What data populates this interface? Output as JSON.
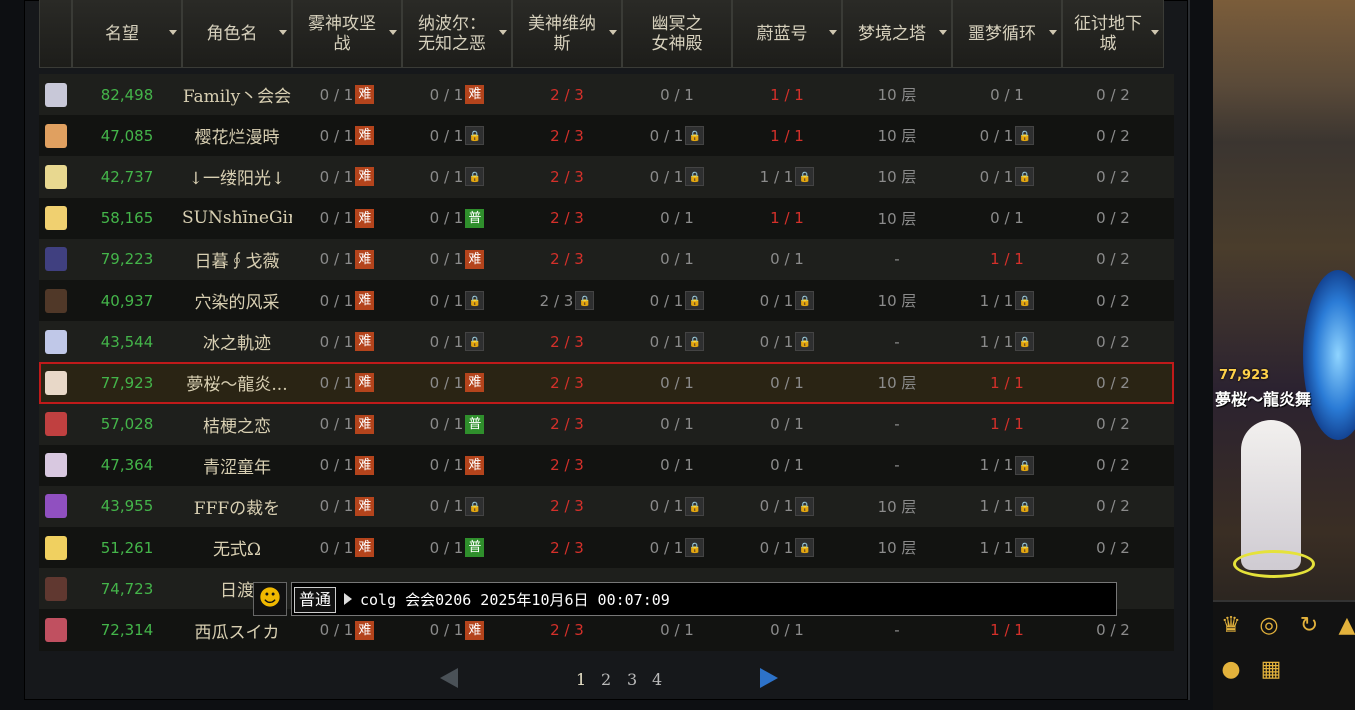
{
  "headers": [
    {
      "label": "名望"
    },
    {
      "label": "角色名"
    },
    {
      "label": "雾神攻坚\n战"
    },
    {
      "label": "纳波尔：\n无知之恶"
    },
    {
      "label": "美神维纳\n斯"
    },
    {
      "label": "幽冥之\n女神殿"
    },
    {
      "label": "蔚蓝号"
    },
    {
      "label": "梦境之塔"
    },
    {
      "label": "噩梦循环"
    },
    {
      "label": "征讨地下\n城"
    }
  ],
  "rows": [
    {
      "fame": "82,498",
      "name": "Family丶会会",
      "c1": "0 / 1",
      "t1": "难",
      "c2": "0 / 1",
      "t2": "难",
      "c3": "2 / 3",
      "c4": "0 / 1",
      "t4": "",
      "c5": "1 / 1",
      "t5": "",
      "c6": "10 层",
      "c7": "0 / 1",
      "t7": "",
      "c8": "0 / 2",
      "avatar": "#c8c8d8"
    },
    {
      "fame": "47,085",
      "name": "樱花烂漫時",
      "c1": "0 / 1",
      "t1": "难",
      "c2": "0 / 1",
      "t2": "锁",
      "c3": "2 / 3",
      "c4": "0 / 1",
      "t4": "锁",
      "c5": "1 / 1",
      "t5": "",
      "c6": "10 层",
      "c7": "0 / 1",
      "t7": "锁",
      "c8": "0 / 2",
      "avatar": "#e0a060"
    },
    {
      "fame": "42,737",
      "name": "↓一缕阳光↓",
      "c1": "0 / 1",
      "t1": "难",
      "c2": "0 / 1",
      "t2": "锁",
      "c3": "2 / 3",
      "c4": "0 / 1",
      "t4": "锁",
      "c5": "1 / 1",
      "t5": "锁",
      "c6": "10 层",
      "c7": "0 / 1",
      "t7": "锁",
      "c8": "0 / 2",
      "avatar": "#e8d890"
    },
    {
      "fame": "58,165",
      "name": "SUNshīneGir",
      "c1": "0 / 1",
      "t1": "难",
      "c2": "0 / 1",
      "t2": "普",
      "c3": "2 / 3",
      "c4": "0 / 1",
      "t4": "",
      "c5": "1 / 1",
      "t5": "",
      "c6": "10 层",
      "c7": "0 / 1",
      "t7": "",
      "c8": "0 / 2",
      "avatar": "#f0d070"
    },
    {
      "fame": "79,223",
      "name": "日暮∮戈薇",
      "c1": "0 / 1",
      "t1": "难",
      "c2": "0 / 1",
      "t2": "难",
      "c3": "2 / 3",
      "c4": "0 / 1",
      "t4": "",
      "c5": "0 / 1",
      "t5": "",
      "c6": "-",
      "c7": "1 / 1",
      "t7": "",
      "c8": "0 / 2",
      "avatar": "#404080"
    },
    {
      "fame": "40,937",
      "name": "穴染的风采",
      "c1": "0 / 1",
      "t1": "难",
      "c2": "0 / 1",
      "t2": "锁",
      "c3": "2 / 3",
      "t3": "锁",
      "c4": "0 / 1",
      "t4": "锁",
      "c5": "0 / 1",
      "t5": "锁",
      "c6": "10 层",
      "c7": "1 / 1",
      "t7": "锁",
      "c8": "0 / 2",
      "avatar": "#503828"
    },
    {
      "fame": "43,544",
      "name": "冰之軌迹",
      "c1": "0 / 1",
      "t1": "难",
      "c2": "0 / 1",
      "t2": "锁",
      "c3": "2 / 3",
      "c4": "0 / 1",
      "t4": "锁",
      "c5": "0 / 1",
      "t5": "锁",
      "c6": "-",
      "c7": "1 / 1",
      "t7": "锁",
      "c8": "0 / 2",
      "avatar": "#c0c8e8"
    },
    {
      "fame": "77,923",
      "name": "夢桜～龍炎...",
      "c1": "0 / 1",
      "t1": "难",
      "c2": "0 / 1",
      "t2": "难",
      "c3": "2 / 3",
      "c4": "0 / 1",
      "t4": "",
      "c5": "0 / 1",
      "t5": "",
      "c6": "10 层",
      "c7": "1 / 1",
      "t7": "",
      "c8": "0 / 2",
      "avatar": "#e8d8c8",
      "selected": true
    },
    {
      "fame": "57,028",
      "name": "桔梗之恋",
      "c1": "0 / 1",
      "t1": "难",
      "c2": "0 / 1",
      "t2": "普",
      "c3": "2 / 3",
      "c4": "0 / 1",
      "t4": "",
      "c5": "0 / 1",
      "t5": "",
      "c6": "-",
      "c7": "1 / 1",
      "t7": "",
      "c8": "0 / 2",
      "avatar": "#c04040"
    },
    {
      "fame": "47,364",
      "name": "青涩童年",
      "c1": "0 / 1",
      "t1": "难",
      "c2": "0 / 1",
      "t2": "难",
      "c3": "2 / 3",
      "c4": "0 / 1",
      "t4": "",
      "c5": "0 / 1",
      "t5": "",
      "c6": "-",
      "c7": "1 / 1",
      "t7": "锁",
      "c8": "0 / 2",
      "avatar": "#d8c8e0"
    },
    {
      "fame": "43,955",
      "name": "FFFの裁を",
      "c1": "0 / 1",
      "t1": "难",
      "c2": "0 / 1",
      "t2": "锁",
      "c3": "2 / 3",
      "c4": "0 / 1",
      "t4": "锁",
      "c5": "0 / 1",
      "t5": "锁",
      "c6": "10 层",
      "c7": "1 / 1",
      "t7": "锁",
      "c8": "0 / 2",
      "avatar": "#9050c0"
    },
    {
      "fame": "51,261",
      "name": "无式Ω",
      "c1": "0 / 1",
      "t1": "难",
      "c2": "0 / 1",
      "t2": "普",
      "c3": "2 / 3",
      "c4": "0 / 1",
      "t4": "锁",
      "c5": "0 / 1",
      "t5": "锁",
      "c6": "10 层",
      "c7": "1 / 1",
      "t7": "锁",
      "c8": "0 / 2",
      "avatar": "#f0d060"
    },
    {
      "fame": "74,723",
      "name": "日渡",
      "c1": "",
      "t1": "",
      "c2": "",
      "t2": "",
      "c3": "",
      "c4": "",
      "t4": "",
      "c5": "",
      "t5": "",
      "c6": "",
      "c7": "",
      "t7": "",
      "c8": "2",
      "avatar": "#603830"
    },
    {
      "fame": "72,314",
      "name": "西瓜スイカ",
      "c1": "0 / 1",
      "t1": "难",
      "c2": "0 / 1",
      "t2": "难",
      "c3": "2 / 3",
      "c4": "0 / 1",
      "t4": "",
      "c5": "0 / 1",
      "t5": "",
      "c6": "-",
      "c7": "1 / 1",
      "t7": "",
      "c8": "0 / 2",
      "avatar": "#c05060"
    }
  ],
  "pager": {
    "pages": [
      "1",
      "2",
      "3",
      "4"
    ],
    "current": "1"
  },
  "chat": {
    "channel": "普通",
    "message": "colg 会会0206 2025年10月6日 00:07:09"
  },
  "scene": {
    "fame": "77,923",
    "character_name": "夢桜～龍炎舞"
  },
  "colors": {
    "fame": "#44b54a",
    "red": "#d4302a",
    "selected_border": "#c01a1a",
    "hard_tag": "#b4441c",
    "normal_tag": "#2f8f2c"
  }
}
